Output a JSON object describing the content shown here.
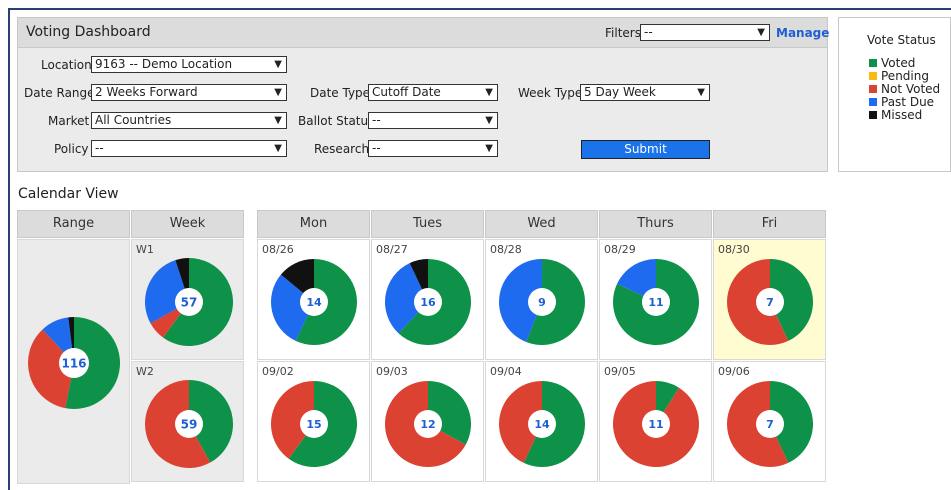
{
  "colors": {
    "voted": "#0e9148",
    "pending": "#fbb714",
    "not_voted": "#dc4232",
    "past_due": "#1e6bef",
    "missed": "#111111",
    "center_text": "#1f5fd1"
  },
  "header": {
    "title": "Voting Dashboard",
    "filters_label": "Filters",
    "filters_value": "--",
    "manage_label": "Manage"
  },
  "form": {
    "location": {
      "label": "Location",
      "value": "9163 -- Demo Location"
    },
    "date_range": {
      "label": "Date Range",
      "value": "2 Weeks Forward"
    },
    "market": {
      "label": "Market",
      "value": "All Countries"
    },
    "policy": {
      "label": "Policy",
      "value": "--"
    },
    "date_type": {
      "label": "Date Type",
      "value": "Cutoff Date"
    },
    "ballot_status": {
      "label": "Ballot Status",
      "value": "--"
    },
    "research": {
      "label": "Research",
      "value": "--"
    },
    "week_type": {
      "label": "Week Type",
      "value": "5 Day Week"
    },
    "submit_label": "Submit"
  },
  "legend": {
    "title": "Vote Status",
    "items": [
      {
        "label": "Voted",
        "color": "#0e9148"
      },
      {
        "label": "Pending",
        "color": "#fbb714"
      },
      {
        "label": "Not Voted",
        "color": "#dc4232"
      },
      {
        "label": "Past Due",
        "color": "#1e6bef"
      },
      {
        "label": "Missed",
        "color": "#111111"
      }
    ]
  },
  "calendar": {
    "title": "Calendar View",
    "headers": {
      "range": "Range",
      "week": "Week",
      "days": [
        "Mon",
        "Tues",
        "Wed",
        "Thurs",
        "Fri"
      ]
    },
    "range_total": {
      "total": "116",
      "share": {
        "voted": 0.53,
        "not_voted": 0.35,
        "past_due": 0.1,
        "missed": 0.02
      }
    },
    "weeks": [
      {
        "label": "W1",
        "total": "57",
        "share": {
          "voted": 0.6,
          "not_voted": 0.07,
          "past_due": 0.28,
          "missed": 0.05
        },
        "days": [
          {
            "date": "08/26",
            "total": "14",
            "share": {
              "voted": 0.57,
              "past_due": 0.29,
              "missed": 0.14
            },
            "highlight": false
          },
          {
            "date": "08/27",
            "total": "16",
            "share": {
              "voted": 0.62,
              "past_due": 0.31,
              "missed": 0.07
            },
            "highlight": false
          },
          {
            "date": "08/28",
            "total": "9",
            "share": {
              "voted": 0.56,
              "past_due": 0.44
            },
            "highlight": false
          },
          {
            "date": "08/29",
            "total": "11",
            "share": {
              "voted": 0.82,
              "past_due": 0.18
            },
            "highlight": false
          },
          {
            "date": "08/30",
            "total": "7",
            "share": {
              "voted": 0.43,
              "not_voted": 0.57
            },
            "highlight": true
          }
        ]
      },
      {
        "label": "W2",
        "total": "59",
        "share": {
          "voted": 0.42,
          "not_voted": 0.58
        },
        "days": [
          {
            "date": "09/02",
            "total": "15",
            "share": {
              "voted": 0.6,
              "not_voted": 0.4
            },
            "highlight": false
          },
          {
            "date": "09/03",
            "total": "12",
            "share": {
              "voted": 0.33,
              "not_voted": 0.67
            },
            "highlight": false
          },
          {
            "date": "09/04",
            "total": "14",
            "share": {
              "voted": 0.57,
              "not_voted": 0.43
            },
            "highlight": false
          },
          {
            "date": "09/05",
            "total": "11",
            "share": {
              "voted": 0.09,
              "not_voted": 0.91
            },
            "highlight": false
          },
          {
            "date": "09/06",
            "total": "7",
            "share": {
              "voted": 0.43,
              "not_voted": 0.57
            },
            "highlight": false
          }
        ]
      }
    ]
  }
}
